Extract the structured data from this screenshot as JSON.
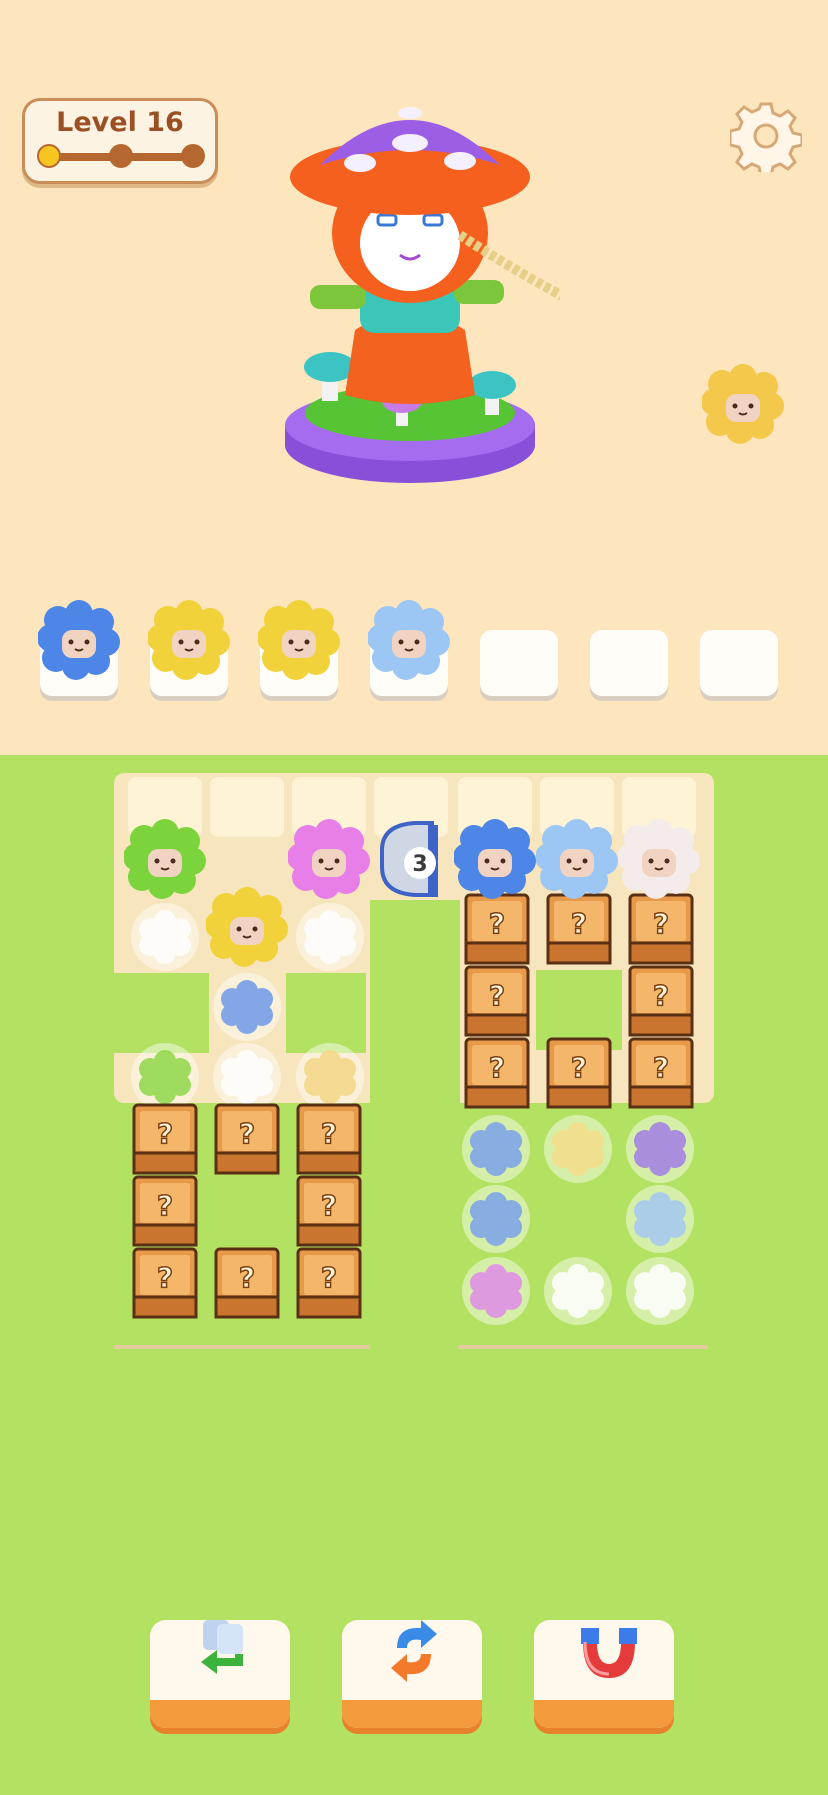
{
  "level": {
    "label": "Level 16",
    "progress_steps": 3,
    "current_step": 1
  },
  "settings": {
    "icon": "gear-icon"
  },
  "rope_target": {
    "color": "#f4c84a"
  },
  "slots": [
    {
      "sheep": "blue",
      "color": "#4d86e6"
    },
    {
      "sheep": "yellow",
      "color": "#f1d23a"
    },
    {
      "sheep": "yellow",
      "color": "#f1d23a"
    },
    {
      "sheep": "light-blue",
      "color": "#9cc6f4"
    },
    {
      "sheep": null
    },
    {
      "sheep": null
    },
    {
      "sheep": null
    }
  ],
  "board": {
    "tunnel_counter": "3",
    "top_sheep": [
      {
        "color": "#7bd43c",
        "name": "green"
      },
      {
        "color": "#f1d23a",
        "name": "yellow"
      },
      {
        "color": "#e87ee8",
        "name": "pink"
      },
      {
        "color": "#4d86e6",
        "name": "blue"
      },
      {
        "color": "#9cc6f4",
        "name": "light-blue"
      },
      {
        "color": "#f3ecea",
        "name": "white"
      }
    ],
    "mystery_box_label": "?",
    "hidden_wool": [
      {
        "color": "#ffffff"
      },
      {
        "color": "#ffffff"
      },
      {
        "color": "#6d9ae8"
      },
      {
        "color": "#8fd84a"
      },
      {
        "color": "#ffffff"
      },
      {
        "color": "#f5d685"
      },
      {
        "color": "#7aa2ec"
      },
      {
        "color": "#f6dd8c"
      },
      {
        "color": "#a27ee8"
      },
      {
        "color": "#7aa2ec"
      },
      {
        "color": "#a5c8f4"
      },
      {
        "color": "#e08ce8"
      },
      {
        "color": "#ffffff"
      },
      {
        "color": "#ffffff"
      }
    ]
  },
  "tools": [
    {
      "name": "undo-button",
      "icon": "undo-icon"
    },
    {
      "name": "shuffle-button",
      "icon": "shuffle-icon"
    },
    {
      "name": "magnet-button",
      "icon": "magnet-icon"
    }
  ]
}
